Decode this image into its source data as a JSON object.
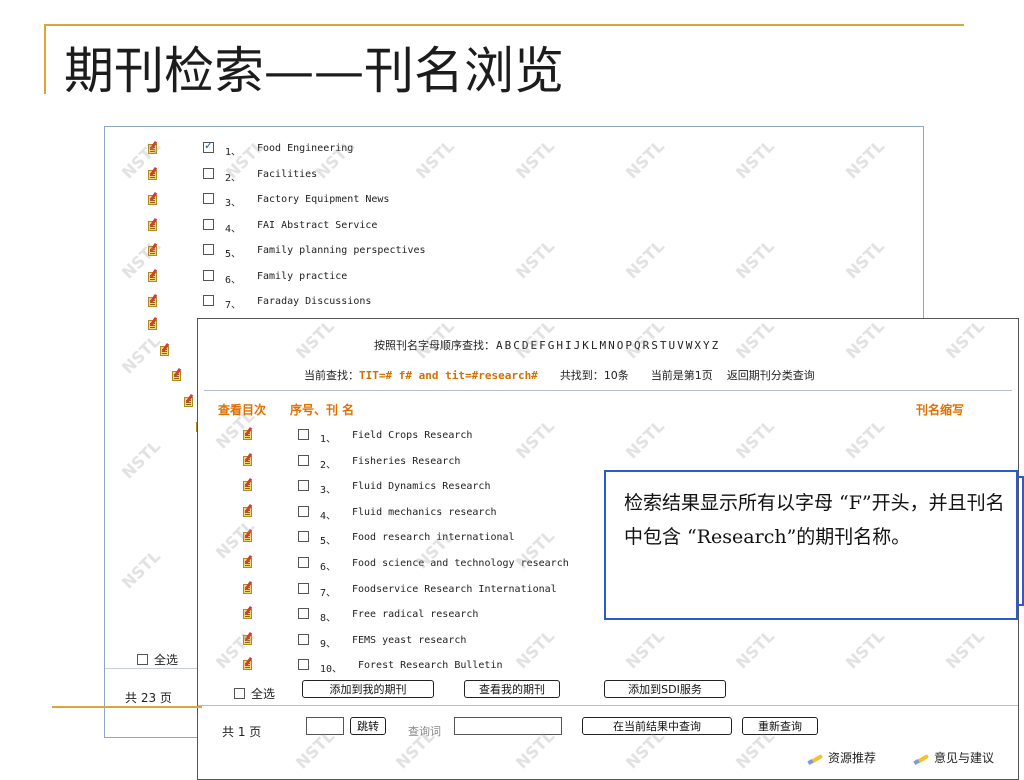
{
  "slide": {
    "title": "期刊检索——刊名浏览"
  },
  "back_list": {
    "items": [
      {
        "num": "1、",
        "name": "Food Engineering",
        "checked": true
      },
      {
        "num": "2、",
        "name": "Facilities",
        "checked": false
      },
      {
        "num": "3、",
        "name": "Factory Equipment News",
        "checked": false
      },
      {
        "num": "4、",
        "name": "FAI Abstract Service",
        "checked": false
      },
      {
        "num": "5、",
        "name": "Family planning perspectives",
        "checked": false
      },
      {
        "num": "6、",
        "name": "Family practice",
        "checked": false
      },
      {
        "num": "7、",
        "name": "Faraday Discussions",
        "checked": false
      }
    ],
    "select_all": "全选",
    "pages": "共 23 页"
  },
  "front": {
    "alphabet_label": "按照刊名字母顺序查找：",
    "letters": [
      "A",
      "B",
      "C",
      "D",
      "E",
      "F",
      "G",
      "H",
      "I",
      "J",
      "K",
      "L",
      "M",
      "N",
      "O",
      "P",
      "Q",
      "R",
      "S",
      "T",
      "U",
      "V",
      "W",
      "X",
      "Y",
      "Z"
    ],
    "current_label": "当前查找：",
    "current_query": "TIT=# f# and tit=#research#",
    "found_label": "共找到：",
    "found_value": "10条",
    "page_info": "当前是第1页",
    "back_link": "返回期刊分类查询",
    "col_toc": "查看目次",
    "col_name": "序号、刊 名",
    "col_abbr": "刊名缩写",
    "items": [
      {
        "num": "1、",
        "name": "Field Crops Research"
      },
      {
        "num": "2、",
        "name": "Fisheries Research"
      },
      {
        "num": "3、",
        "name": "Fluid Dynamics Research"
      },
      {
        "num": "4、",
        "name": "Fluid mechanics research"
      },
      {
        "num": "5、",
        "name": "Food research international"
      },
      {
        "num": "6、",
        "name": "Food science and technology research"
      },
      {
        "num": "7、",
        "name": "Foodservice Research International"
      },
      {
        "num": "8、",
        "name": "Free radical research"
      },
      {
        "num": "9、",
        "name": "FEMS yeast research"
      },
      {
        "num": "10、",
        "name": "Forest Research Bulletin"
      }
    ],
    "select_all": "全选",
    "btn_add_my": "添加到我的期刊",
    "btn_view_my": "查看我的期刊",
    "btn_add_sdi": "添加到SDI服务",
    "pages": "共 1 页",
    "btn_jump": "跳转",
    "query_label": "查询词",
    "btn_search_in": "在当前结果中查询",
    "btn_requery": "重新查询",
    "link_recommend": "资源推荐",
    "link_feedback": "意见与建议"
  },
  "callout": {
    "text": "检索结果显示所有以字母 “F”开头，并且刊名中包含 “Research”的期刊名称。"
  },
  "watermark": {
    "text": "NSTL"
  },
  "colors": {
    "accent_line": "#d8a63a",
    "header_orange": "#e07000",
    "callout_border": "#2a5bd0"
  }
}
